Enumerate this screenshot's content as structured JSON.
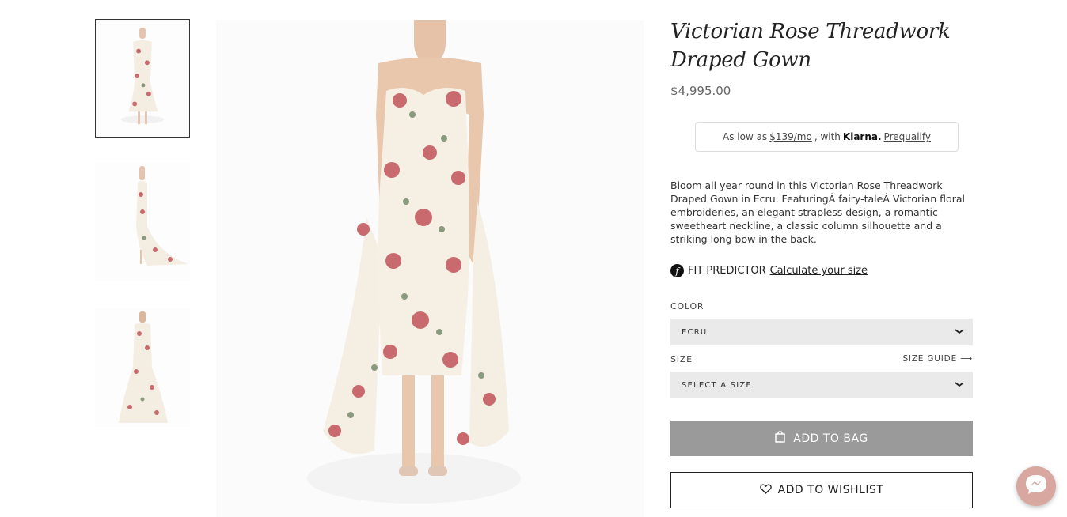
{
  "product": {
    "title": "Victorian Rose Threadwork Draped Gown",
    "price": "$4,995.00",
    "description": "Bloom all year round in this Victorian Rose Threadwork Draped Gown in Ecru. FeaturingÂ fairy-taleÂ Victorian floral embroideries, an elegant strapless design, a romantic sweetheart neckline, a classic column silhouette and a striking long bow in the back."
  },
  "klarna": {
    "prefix": "As low as",
    "amount": "$139/mo",
    "with": ", with",
    "brand": "Klarna.",
    "link": "Prequalify"
  },
  "fit": {
    "icon_letter": "f",
    "label": "FIT PREDICTOR",
    "link": "Calculate your size"
  },
  "color": {
    "label": "COLOR",
    "selected": "ECRU"
  },
  "size": {
    "label": "SIZE",
    "guide": "SIZE GUIDE ⟶",
    "placeholder": "SELECT A SIZE"
  },
  "buttons": {
    "add_to_bag": "ADD TO BAG",
    "add_to_wishlist": "ADD TO WISHLIST"
  },
  "icons": {
    "chevron": "⌄",
    "bag": "bag-icon",
    "heart": "heart-icon",
    "messenger": "messenger-icon"
  },
  "colors": {
    "add_to_bag_bg": "#9a9a9a",
    "messenger_bg": "#d8a8a0",
    "dress": "#f6efe4",
    "rose": "#c86a6e",
    "leaf": "#8a9a7e"
  }
}
